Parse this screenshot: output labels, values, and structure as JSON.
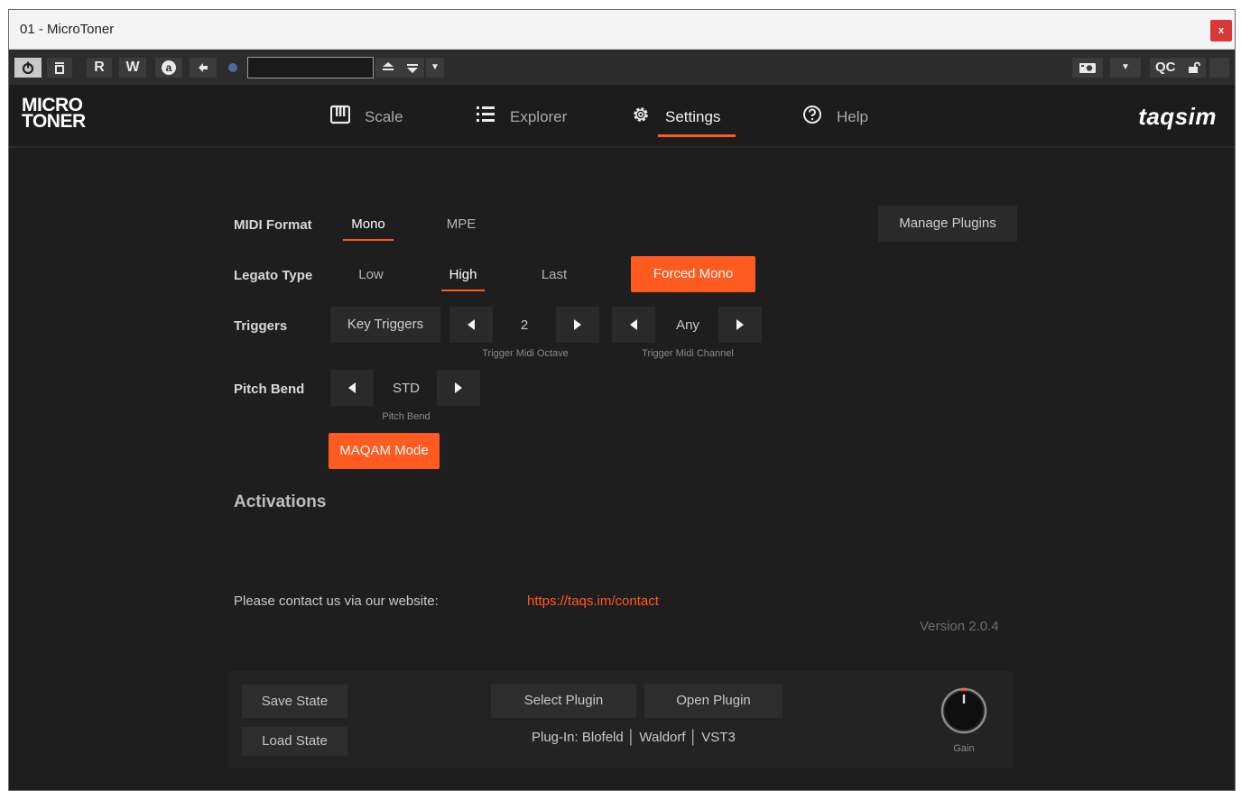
{
  "window": {
    "title": "01 - MicroToner",
    "close_label": "x"
  },
  "hostbar": {
    "buttons": {
      "read": "R",
      "write": "W",
      "a": "a",
      "qc": "QC"
    },
    "preset_value": "",
    "caret": "▼"
  },
  "app": {
    "logo_line1": "MICRO",
    "logo_line2": "TONER",
    "brand": "taqsim",
    "tabs": [
      {
        "label": "Scale",
        "icon": "piano-keys-icon"
      },
      {
        "label": "Explorer",
        "icon": "list-icon"
      },
      {
        "label": "Settings",
        "icon": "gear-icon"
      },
      {
        "label": "Help",
        "icon": "help-circle-icon"
      }
    ],
    "active_tab": "Settings",
    "accent_color": "#ff5a1f"
  },
  "settings": {
    "midi_format": {
      "label": "MIDI Format",
      "options": [
        "Mono",
        "MPE"
      ],
      "selected": "Mono"
    },
    "manage_plugins_label": "Manage Plugins",
    "legato_type": {
      "label": "Legato Type",
      "options": [
        "Low",
        "High",
        "Last"
      ],
      "selected": "High",
      "forced_mono_label": "Forced Mono"
    },
    "triggers": {
      "label": "Triggers",
      "key_triggers_label": "Key Triggers",
      "octave_value": "2",
      "octave_caption": "Trigger Midi Octave",
      "channel_value": "Any",
      "channel_caption": "Trigger Midi Channel"
    },
    "pitch_bend": {
      "label": "Pitch Bend",
      "value": "STD",
      "caption": "Pitch Bend"
    },
    "maqam_mode_label": "MAQAM Mode",
    "activations_heading": "Activations",
    "contact_text": "Please contact us via our website:",
    "contact_link": "https://taqs.im/contact",
    "version": "Version 2.0.4"
  },
  "footer": {
    "save_state": "Save State",
    "load_state": "Load State",
    "select_plugin": "Select Plugin",
    "open_plugin": "Open Plugin",
    "plugin_info": "Plug-In: Blofeld │ Waldorf │ VST3",
    "gain_label": "Gain"
  }
}
